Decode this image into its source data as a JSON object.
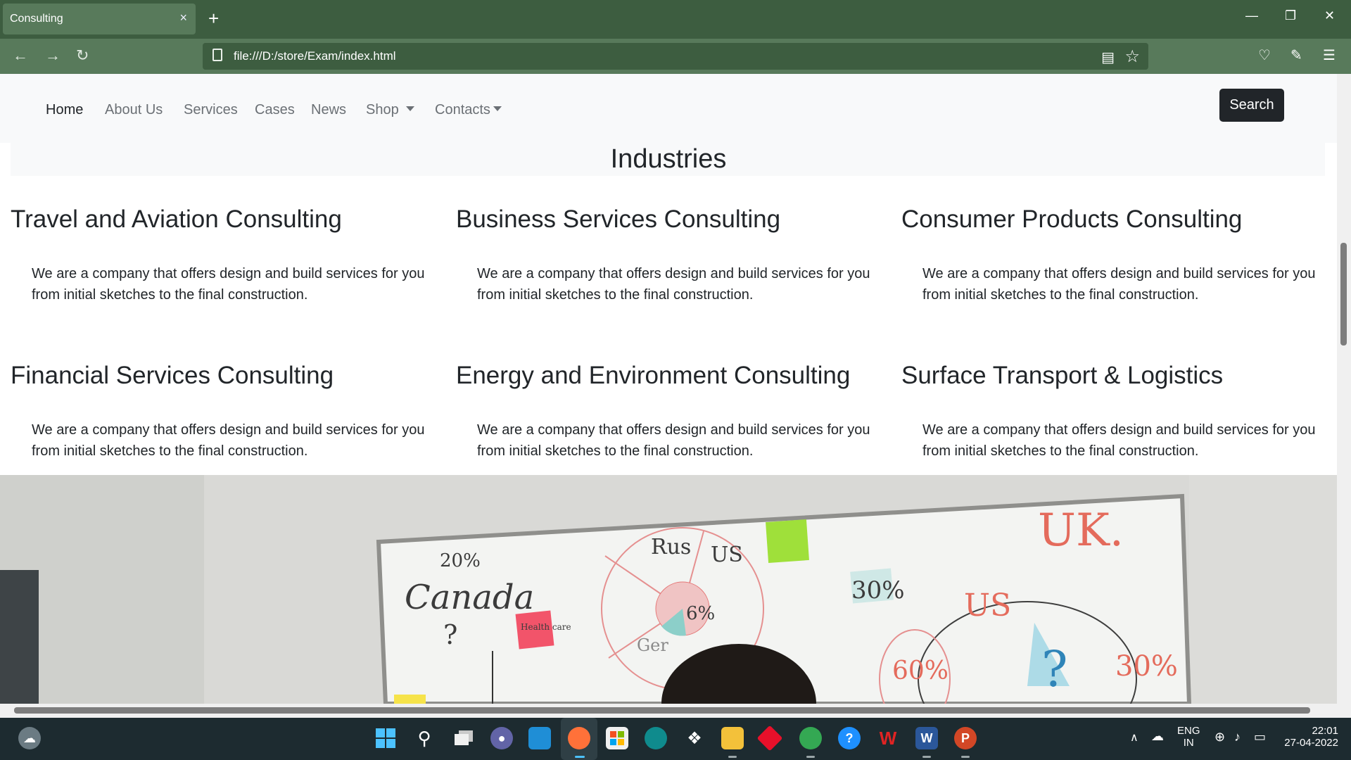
{
  "browser": {
    "tab_title": "Consulting",
    "tab_close": "×",
    "new_tab": "+",
    "url": "file:///D:/store/Exam/index.html",
    "window": {
      "minimize": "—",
      "restore": "❐",
      "close": "✕"
    }
  },
  "nav": {
    "links": [
      "Home",
      "About Us",
      "Services",
      "Cases",
      "News",
      "Shop",
      "Contacts"
    ],
    "active": "Home",
    "search_label": "Search"
  },
  "industries": {
    "heading": "Industries",
    "cards": [
      {
        "title": "Travel and Aviation Consulting",
        "text": "We are a company that offers design and build services for you from initial sketches to the final construction."
      },
      {
        "title": "Business Services Consulting",
        "text": "We are a company that offers design and build services for you from initial sketches to the final construction."
      },
      {
        "title": "Consumer Products Consulting",
        "text": "We are a company that offers design and build services for you from initial sketches to the final construction."
      },
      {
        "title": "Financial Services Consulting",
        "text": "We are a company that offers design and build services for you from initial sketches to the final construction."
      },
      {
        "title": "Energy and Environment Consulting",
        "text": "We are a company that offers design and build services for you from initial sketches to the final construction."
      },
      {
        "title": "Surface Transport & Logistics",
        "text": "We are a company that offers design and build services for you from initial sketches to the final construction."
      }
    ]
  },
  "whiteboard": {
    "notes": [
      "20%",
      "Canada",
      "?",
      "Rus",
      "US",
      "6%",
      "Ger",
      "Health care",
      "30%",
      "UK.",
      "US",
      "60%",
      "30%",
      "?"
    ]
  },
  "taskbar": {
    "lang": "ENG",
    "region": "IN",
    "time": "22:01",
    "date": "27-04-2022"
  },
  "colors": {
    "tabbar": "#3d5d40",
    "toolbar": "#587a5b",
    "navbar_bg": "#f8f9fa",
    "search_btn": "#212529",
    "taskbar": "#1d2b30"
  }
}
